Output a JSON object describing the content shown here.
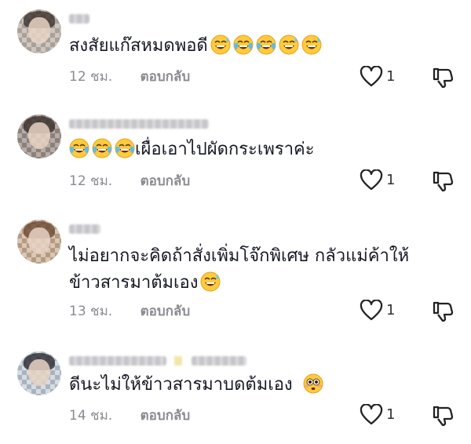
{
  "colors": {
    "text": "#161823",
    "meta": "#8a8b91",
    "icon": "#222222"
  },
  "comments": [
    {
      "text": "สงสัยแก๊สหมดพอดี",
      "emojis": [
        "sweat-smile",
        "tears-of-joy",
        "tears-of-joy",
        "sweat-smile",
        "sweat-smile"
      ],
      "emoji_position": "after",
      "time": "12 ชม.",
      "reply": "ตอบกลับ",
      "likes": "1"
    },
    {
      "text": "เผื่อเอาไปผัดกระเพราค่ะ",
      "emojis": [
        "tears-of-joy",
        "tears-of-joy",
        "tears-of-joy"
      ],
      "emoji_position": "before",
      "time": "12 ชม.",
      "reply": "ตอบกลับ",
      "likes": "1"
    },
    {
      "text_line1": "ไม่อยากจะคิดถ้าสั่งเพิ่มโจ๊กพิเศษ กลัวแม่ค้าให้",
      "text_line2": "ข้าวสารมาต้มเอง",
      "emojis": [
        "sweat-smile"
      ],
      "emoji_position": "after",
      "time": "13 ชม.",
      "reply": "ตอบกลับ",
      "likes": "1"
    },
    {
      "text": "ดีนะไม่ให้ข้าวสารมาบดต้มเอง",
      "emojis": [
        "flushed"
      ],
      "emoji_position": "after",
      "time": "14 ชม.",
      "reply": "ตอบกลับ",
      "likes": "1"
    }
  ]
}
